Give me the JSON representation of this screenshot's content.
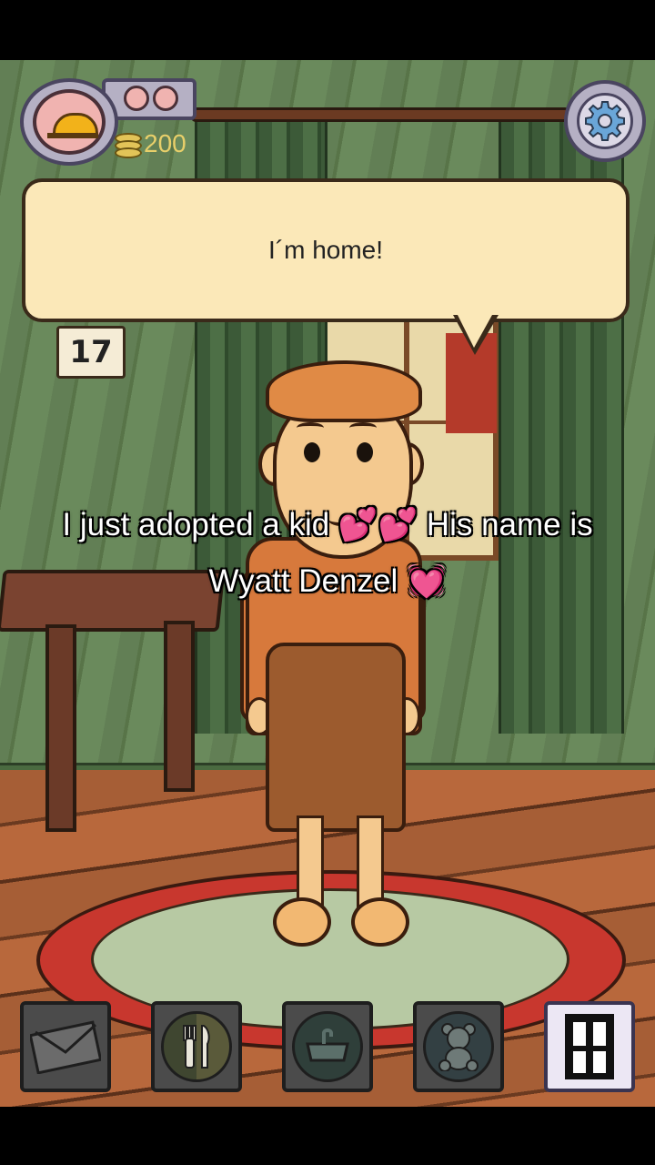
{
  "hud": {
    "time_of_day_icon": "sunrise-icon",
    "coins_icon": "coin-stack-icon",
    "coins": "200",
    "settings_icon": "gear-icon"
  },
  "scene": {
    "calendar_day": "17"
  },
  "dialogue": {
    "text": "I´m home!"
  },
  "caption": {
    "line1": "I just adopted a kid 💕💕 His name is",
    "line2": "Wyatt Denzel 💓"
  },
  "toolbar": {
    "items": [
      {
        "icon": "mail-icon",
        "active": false
      },
      {
        "icon": "fork-knife-icon",
        "active": false
      },
      {
        "icon": "sink-icon",
        "active": false
      },
      {
        "icon": "teddy-bear-icon",
        "active": false
      },
      {
        "icon": "window-icon",
        "active": true
      }
    ]
  },
  "colors": {
    "bubble": "#fbe8b8",
    "coin_text": "#e8cf6a",
    "hud_frame": "#b5b0c4"
  }
}
